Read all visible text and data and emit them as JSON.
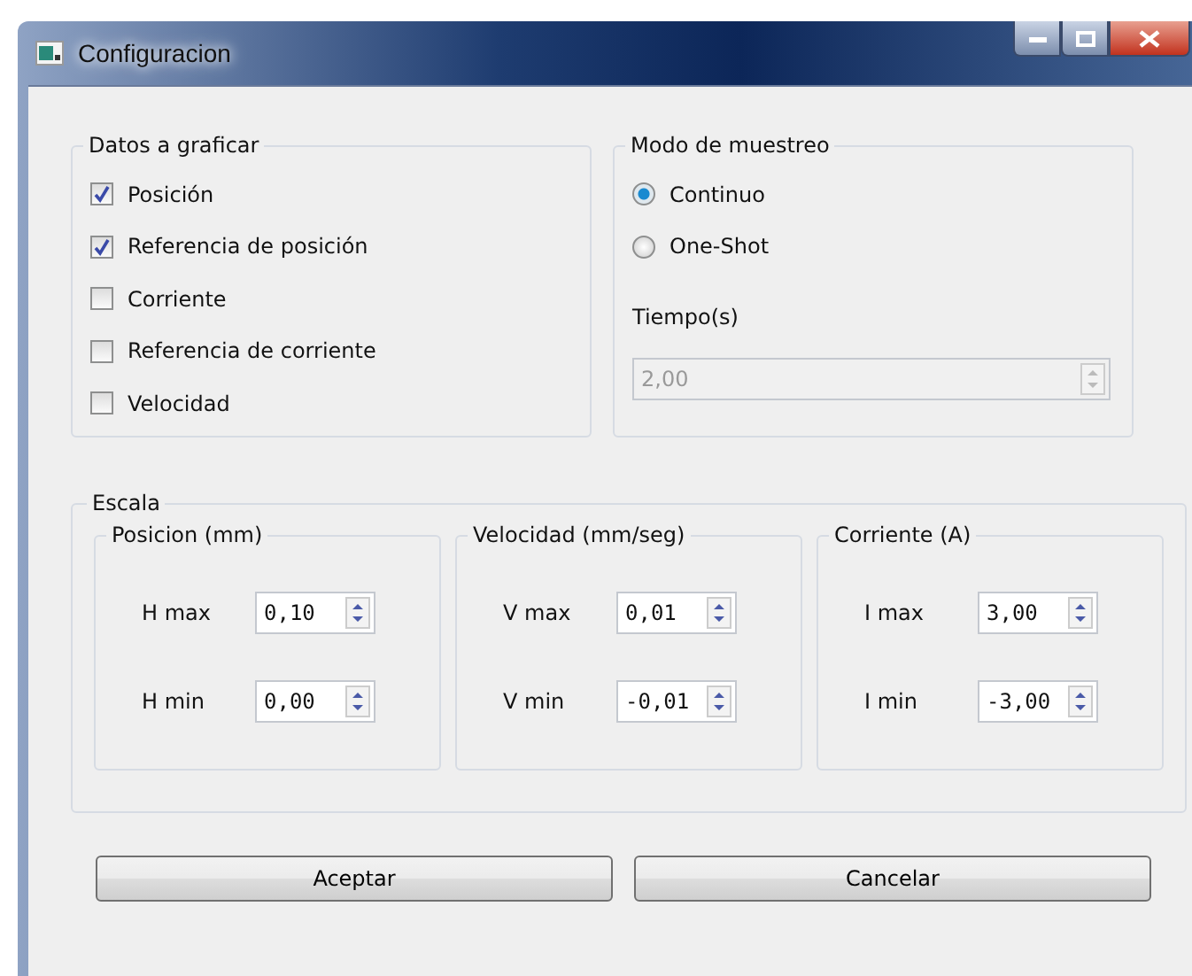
{
  "window": {
    "title": "Configuracion"
  },
  "datos": {
    "title": "Datos a graficar",
    "items": [
      {
        "label": "Posición",
        "checked": true
      },
      {
        "label": "Referencia de posición",
        "checked": true
      },
      {
        "label": "Corriente",
        "checked": false
      },
      {
        "label": "Referencia de corriente",
        "checked": false
      },
      {
        "label": "Velocidad",
        "checked": false
      }
    ]
  },
  "modo": {
    "title": "Modo de muestreo",
    "options": [
      {
        "label": "Continuo",
        "selected": true
      },
      {
        "label": "One-Shot",
        "selected": false
      }
    ],
    "time_label": "Tiempo(s)",
    "time_value": "2,00",
    "time_disabled": true
  },
  "escala": {
    "title": "Escala",
    "groups": [
      {
        "title": "Posicion (mm)",
        "fields": [
          {
            "label": "H max",
            "value": "0,10"
          },
          {
            "label": "H min",
            "value": "0,00"
          }
        ]
      },
      {
        "title": "Velocidad (mm/seg)",
        "fields": [
          {
            "label": "V max",
            "value": "0,01"
          },
          {
            "label": "V min",
            "value": "-0,01"
          }
        ]
      },
      {
        "title": "Corriente (A)",
        "fields": [
          {
            "label": "I max",
            "value": "3,00"
          },
          {
            "label": "I min",
            "value": "-3,00"
          }
        ]
      }
    ]
  },
  "buttons": [
    "Aceptar",
    "Cancelar"
  ]
}
